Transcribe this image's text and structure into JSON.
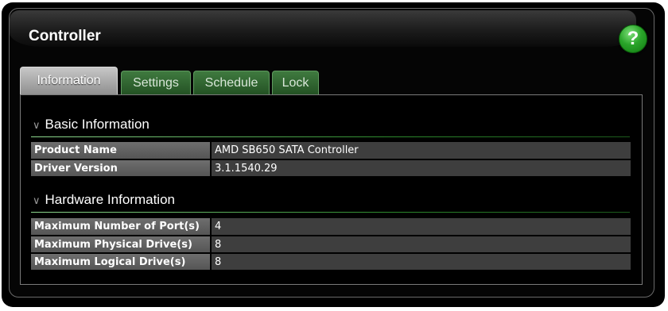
{
  "header": {
    "title": "Controller",
    "help_icon": "?"
  },
  "tabs": [
    {
      "label": "Information",
      "active": true
    },
    {
      "label": "Settings",
      "active": false
    },
    {
      "label": "Schedule",
      "active": false
    },
    {
      "label": "Lock",
      "active": false
    }
  ],
  "sections": [
    {
      "title": "Basic Information",
      "rows": [
        {
          "label": "Product Name",
          "value": "AMD SB650 SATA Controller"
        },
        {
          "label": "Driver Version",
          "value": "3.1.1540.29"
        }
      ]
    },
    {
      "title": "Hardware Information",
      "rows": [
        {
          "label": "Maximum Number of Port(s)",
          "value": "4"
        },
        {
          "label": "Maximum Physical Drive(s)",
          "value": "8"
        },
        {
          "label": "Maximum Logical Drive(s)",
          "value": "8"
        }
      ]
    }
  ],
  "colors": {
    "accent_green": "#2d8a2d",
    "tab_green": "#2f662f",
    "panel_bg": "#000000"
  }
}
